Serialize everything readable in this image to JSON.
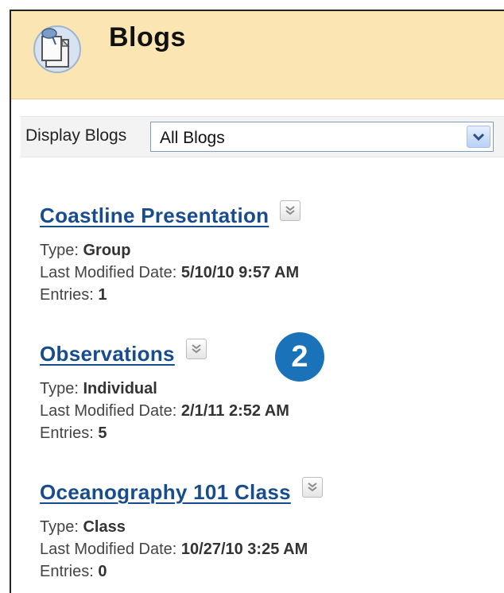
{
  "header": {
    "title": "Blogs",
    "icon": "blog-tool-icon"
  },
  "filter": {
    "label": "Display Blogs",
    "selected": "All Blogs",
    "icon": "chevron-down-icon"
  },
  "blogs": [
    {
      "title": "Coastline Presentation",
      "type_label": "Type:",
      "type": "Group",
      "modified_label": "Last Modified Date:",
      "modified": "5/10/10 9:57 AM",
      "entries_label": "Entries:",
      "entries": "1"
    },
    {
      "title": "Observations",
      "type_label": "Type:",
      "type": "Individual",
      "modified_label": "Last Modified Date:",
      "modified": "2/1/11 2:52 AM",
      "entries_label": "Entries:",
      "entries": "5"
    },
    {
      "title": "Oceanography 101 Class",
      "type_label": "Type:",
      "type": "Class",
      "modified_label": "Last Modified Date:",
      "modified": "10/27/10 3:25 AM",
      "entries_label": "Entries:",
      "entries": "0"
    }
  ],
  "step_badge": "2",
  "colors": {
    "header_bg": "#fbe6b3",
    "link": "#174c8f",
    "badge": "#1a73b9"
  }
}
